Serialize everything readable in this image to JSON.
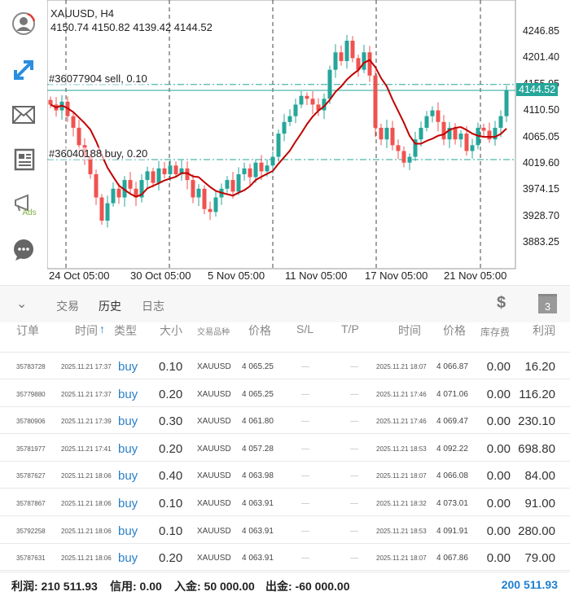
{
  "chart": {
    "symbol_tf": "XAUUSD, H4",
    "ohlc": "4150.74 4150.82 4139.42 4144.52",
    "current_price": "4144.52",
    "sell_order": "#36077904 sell, 0.10",
    "buy_order": "#36040188 buy, 0.20",
    "price_labels": [
      "4246.85",
      "4201.40",
      "4155.95",
      "4110.50",
      "4065.05",
      "4019.60",
      "3974.15",
      "3928.70",
      "3883.25"
    ],
    "date_labels": [
      "24 Oct 05:00",
      "30 Oct 05:00",
      "5 Nov 05:00",
      "11 Nov 05:00",
      "17 Nov 05:00",
      "21 Nov 05:00"
    ],
    "colors": {
      "bull": "#26a69a",
      "bear": "#ef5350",
      "ma": "#c00000",
      "line": "#26a69a"
    }
  },
  "chart_data": {
    "type": "candlestick",
    "ylim": [
      3860,
      4270
    ],
    "sell_level": 4155.95,
    "buy_level": 4019.6,
    "current": 4144.52,
    "closes": [
      4120,
      4110,
      4125,
      4100,
      4080,
      4050,
      4030,
      4000,
      3960,
      3920,
      3950,
      3975,
      3960,
      3990,
      3975,
      3960,
      3990,
      4005,
      3985,
      4010,
      4000,
      4015,
      4000,
      4010,
      3990,
      3960,
      3975,
      3940,
      3935,
      3960,
      3975,
      3990,
      3970,
      4000,
      4010,
      3995,
      4020,
      4005,
      4015,
      4030,
      4070,
      4090,
      4100,
      4120,
      4135,
      4130,
      4120,
      4110,
      4130,
      4180,
      4210,
      4195,
      4230,
      4200,
      4180,
      4210,
      4170,
      4080,
      4060,
      4080,
      4050,
      4040,
      4020,
      4030,
      4060,
      4080,
      4100,
      4110,
      4090,
      4060,
      4080,
      4060,
      4070,
      4040,
      4050,
      4080,
      4075,
      4060,
      4080,
      4100,
      4144.52
    ]
  },
  "tabs": {
    "collapse": "⌄",
    "trade": "交易",
    "history": "历史",
    "journal": "日志",
    "calendar_day": "3"
  },
  "table": {
    "headers": [
      "订单",
      "时间",
      "类型",
      "大小",
      "交易品种",
      "价格",
      "S/L",
      "T/P",
      "时间",
      "价格",
      "库存费",
      "利润"
    ],
    "sort_arrow": "↑",
    "rows": [
      [
        "35783728",
        "2025.11.21 17:37",
        "buy",
        "0.10",
        "XAUUSD",
        "4 065.25",
        "—",
        "—",
        "2025.11.21 18:07",
        "4 066.87",
        "0.00",
        "16.20"
      ],
      [
        "35779880",
        "2025.11.21 17:37",
        "buy",
        "0.20",
        "XAUUSD",
        "4 065.25",
        "—",
        "—",
        "2025.11.21 17:46",
        "4 071.06",
        "0.00",
        "116.20"
      ],
      [
        "35780906",
        "2025.11.21 17:39",
        "buy",
        "0.30",
        "XAUUSD",
        "4 061.80",
        "—",
        "—",
        "2025.11.21 17:46",
        "4 069.47",
        "0.00",
        "230.10"
      ],
      [
        "35781977",
        "2025.11.21 17:41",
        "buy",
        "0.20",
        "XAUUSD",
        "4 057.28",
        "—",
        "—",
        "2025.11.21 18:53",
        "4 092.22",
        "0.00",
        "698.80"
      ],
      [
        "35787627",
        "2025.11.21 18:06",
        "buy",
        "0.40",
        "XAUUSD",
        "4 063.98",
        "—",
        "—",
        "2025.11.21 18:07",
        "4 066.08",
        "0.00",
        "84.00"
      ],
      [
        "35787867",
        "2025.11.21 18:06",
        "buy",
        "0.10",
        "XAUUSD",
        "4 063.91",
        "—",
        "—",
        "2025.11.21 18:32",
        "4 073.01",
        "0.00",
        "91.00"
      ],
      [
        "35792258",
        "2025.11.21 18:06",
        "buy",
        "0.10",
        "XAUUSD",
        "4 063.91",
        "—",
        "—",
        "2025.11.21 18:53",
        "4 091.91",
        "0.00",
        "280.00"
      ],
      [
        "35787631",
        "2025.11.21 18:06",
        "buy",
        "0.20",
        "XAUUSD",
        "4 063.91",
        "—",
        "—",
        "2025.11.21 18:07",
        "4 067.86",
        "0.00",
        "79.00"
      ]
    ]
  },
  "footer": {
    "profit": "利润: 210 511.93",
    "credit": "信用: 0.00",
    "deposit": "入金: 50 000.00",
    "withdrawal": "出金: -60 000.00",
    "balance": "200 511.93"
  },
  "sidebar": {
    "ads": "Ads"
  }
}
